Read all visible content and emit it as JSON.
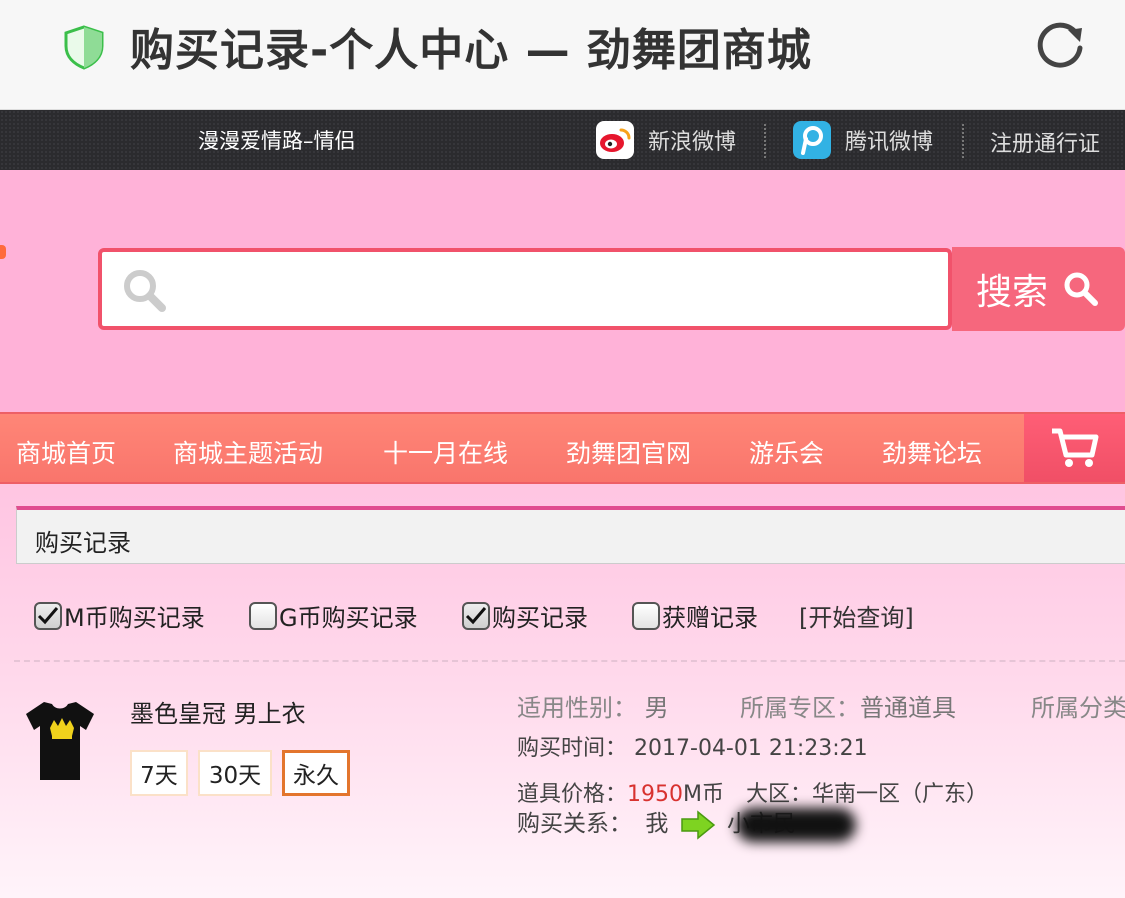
{
  "browser": {
    "title": "购买记录-个人中心 — 劲舞团商城"
  },
  "topbar": {
    "marquee": "漫漫爱情路–情侣",
    "sina_label": "新浪微博",
    "tencent_label": "腾讯微博",
    "register_label": "注册通行证"
  },
  "search": {
    "placeholder": "",
    "button_label": "搜索"
  },
  "nav": {
    "items": [
      "商城首页",
      "商城主题活动",
      "十一月在线",
      "劲舞团官网",
      "游乐会",
      "劲舞论坛"
    ]
  },
  "section": {
    "title": "购买记录"
  },
  "filters": {
    "items": [
      {
        "label": "M币购买记录",
        "checked": true
      },
      {
        "label": "G币购买记录",
        "checked": false
      },
      {
        "label": "购买记录",
        "checked": true
      },
      {
        "label": "获赠记录",
        "checked": false
      }
    ],
    "query_label": "[开始查询]"
  },
  "record": {
    "name": "墨色皇冠 男上衣",
    "durations": [
      "7天",
      "30天",
      "永久"
    ],
    "selected_duration": "永久",
    "gender_label": "适用性别：",
    "gender_value": "男",
    "zone_label": "所属专区：",
    "zone_value": "普通道具",
    "category_label": "所属分类",
    "time_label": "购买时间：",
    "time_value": "2017-04-01 21:23:21",
    "price_label": "道具价格：",
    "price_value": "1950",
    "price_unit": "M币",
    "region_label": "大区：",
    "region_value": "华南一区（广东）",
    "relation_label": "购买关系：",
    "relation_from": "我",
    "relation_to": "小市民"
  },
  "colors": {
    "header_pink": "#ffb2d8",
    "nav_coral": "#f9756c",
    "search_red": "#f6677d",
    "price_red": "#d8322f",
    "selected_border": "#e3752d"
  }
}
